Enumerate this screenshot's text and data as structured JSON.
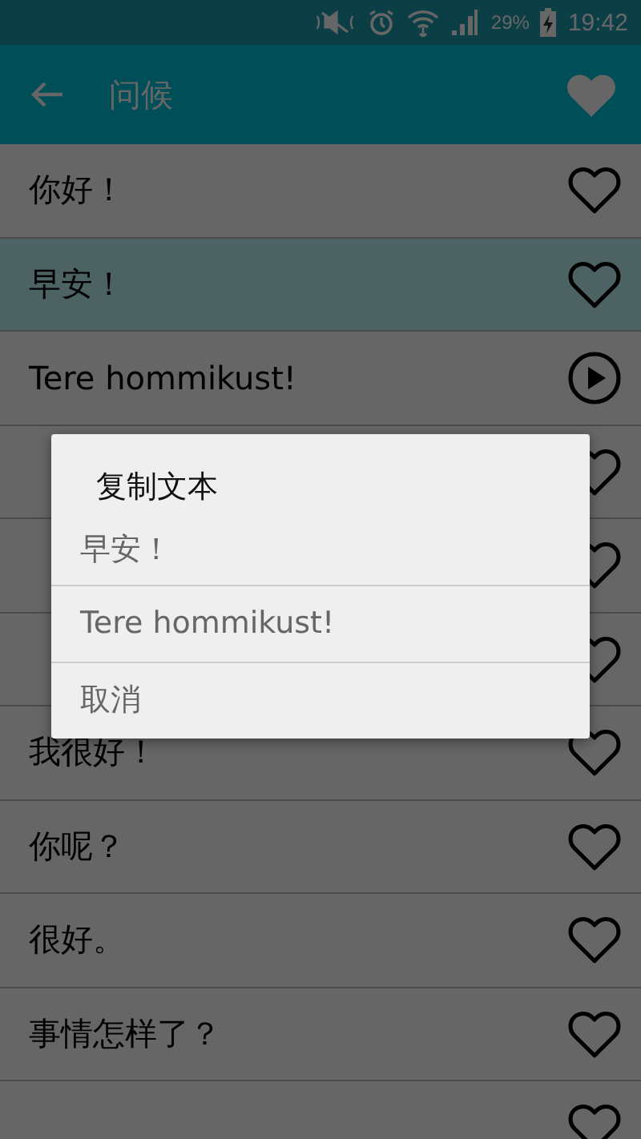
{
  "status_bar": {
    "battery": "29%",
    "time": "19:42"
  },
  "app_bar": {
    "title": "问候"
  },
  "rows": [
    {
      "kind": "favorite",
      "text": "你好！",
      "selected": false
    },
    {
      "kind": "favorite",
      "text": "早安！",
      "selected": true
    },
    {
      "kind": "play",
      "text": "Tere hommikust!",
      "selected": false
    },
    {
      "kind": "favorite",
      "selected": false
    },
    {
      "kind": "favorite",
      "selected": false
    },
    {
      "kind": "favorite",
      "selected": false
    },
    {
      "kind": "favorite",
      "text": "我很好！",
      "selected": false
    },
    {
      "kind": "favorite",
      "text": "你呢？",
      "selected": false
    },
    {
      "kind": "favorite",
      "text": "很好。",
      "selected": false
    },
    {
      "kind": "favorite",
      "text": "事情怎样了？",
      "selected": false
    },
    {
      "kind": "favorite",
      "selected": false
    }
  ],
  "dialog": {
    "title": "复制文本",
    "items": [
      "早安！",
      "Tere hommikust!",
      "取消"
    ]
  }
}
